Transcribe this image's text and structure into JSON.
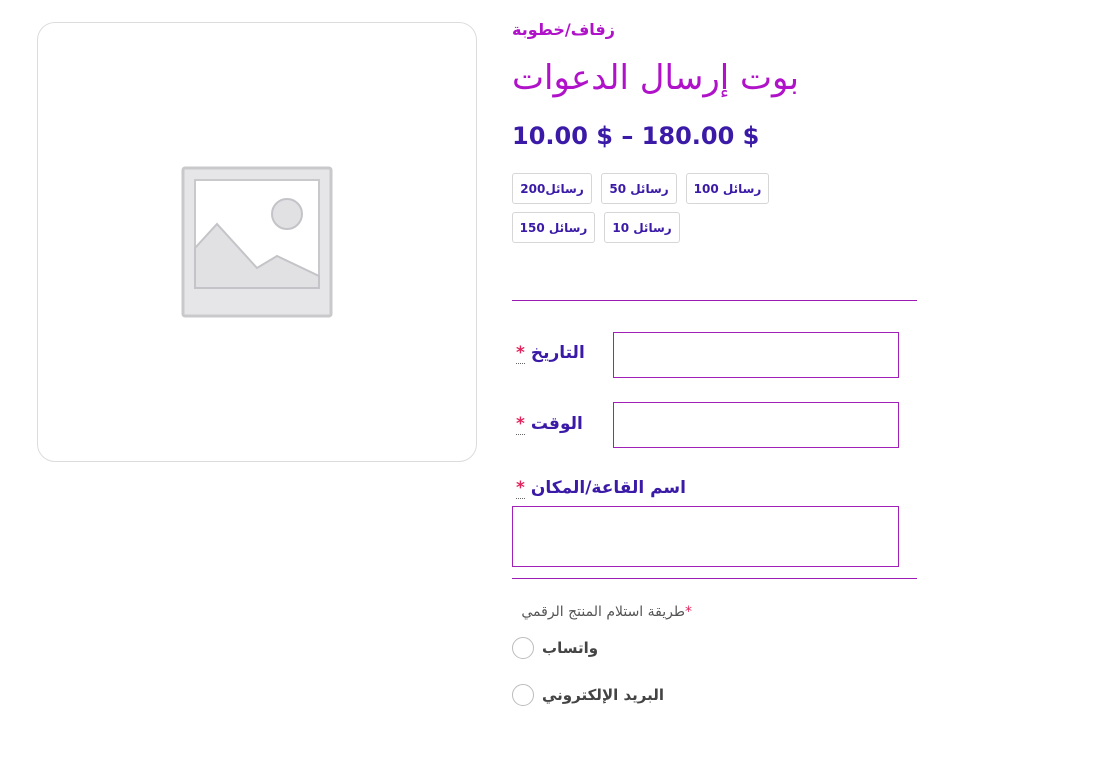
{
  "product": {
    "breadcrumb": "زفاف/خطوبة",
    "title": "بوت إرسال الدعوات",
    "price_range": "10.00 $ – 180.00 $"
  },
  "variations": [
    {
      "label": "رسائل200"
    },
    {
      "label": "رسائل 50"
    },
    {
      "label": "رسائل 100"
    },
    {
      "label": "رسائل 150"
    },
    {
      "label": "رسائل 10"
    }
  ],
  "form": {
    "required_marker": "*",
    "date_label": "التاريخ",
    "time_label": "الوقت",
    "venue_label": "اسم القاعة/المكان",
    "date_value": "",
    "time_value": "",
    "venue_value": ""
  },
  "delivery": {
    "label": "طريقة استلام المنتج الرقمي",
    "required_marker": "*",
    "options": [
      {
        "label": "واتساب",
        "checked": false
      },
      {
        "label": "البريد الإلكتروني",
        "checked": false
      }
    ]
  },
  "colors": {
    "accent_purple": "#b012c9",
    "heading_indigo": "#3a1aa6",
    "field_border": "#a020b8",
    "required_red": "#e0245e"
  },
  "icons": {
    "product_placeholder": "image-placeholder-icon"
  }
}
